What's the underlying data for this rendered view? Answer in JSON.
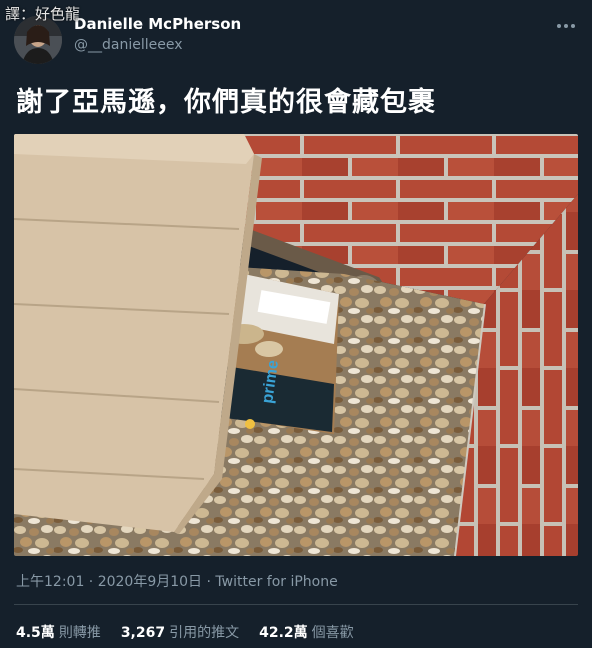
{
  "watermark": "譯：好色龍",
  "author": {
    "display_name": "Danielle McPherson",
    "handle": "@__danielleeex"
  },
  "tweet": {
    "text": "謝了亞馬遜，你們真的很會藏包裹"
  },
  "photo": {
    "box_label": "prime"
  },
  "meta": {
    "timestamp": "上午12:01 · 2020年9月10日 · Twitter for iPhone"
  },
  "stats": {
    "retweets": {
      "count": "4.5萬",
      "label": "則轉推"
    },
    "quotes": {
      "count": "3,267",
      "label": "引用的推文"
    },
    "likes": {
      "count": "42.2萬",
      "label": "個喜歡"
    }
  },
  "icons": {
    "more": "more-dots-icon"
  },
  "colors": {
    "background": "#15202b",
    "secondary_text": "#8899a6",
    "divider": "#38444d"
  }
}
